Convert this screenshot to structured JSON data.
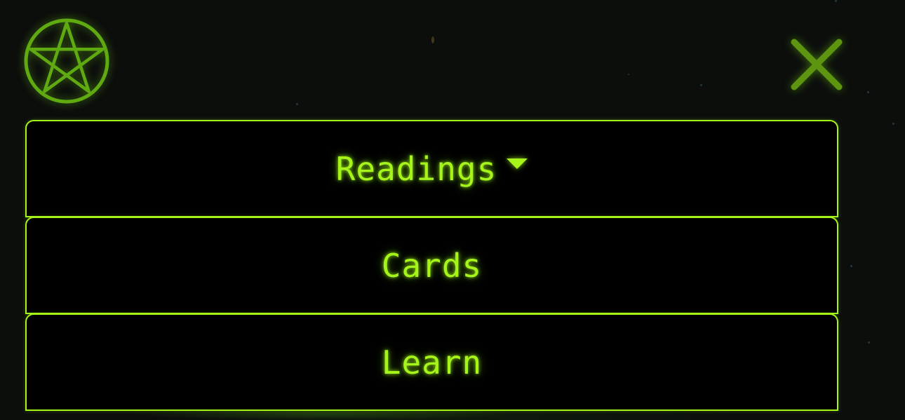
{
  "header": {
    "logo_icon": "pentagram-icon",
    "close_icon": "close-icon"
  },
  "menu": {
    "items": [
      {
        "label": "Readings",
        "has_dropdown": true,
        "icon": "caret-down-icon"
      },
      {
        "label": "Cards",
        "has_dropdown": false
      },
      {
        "label": "Learn",
        "has_dropdown": false
      }
    ]
  },
  "colors": {
    "accent": "#a6f51a",
    "icon_green": "#5faa10",
    "background": "#0c0e0c",
    "panel": "#000000"
  }
}
